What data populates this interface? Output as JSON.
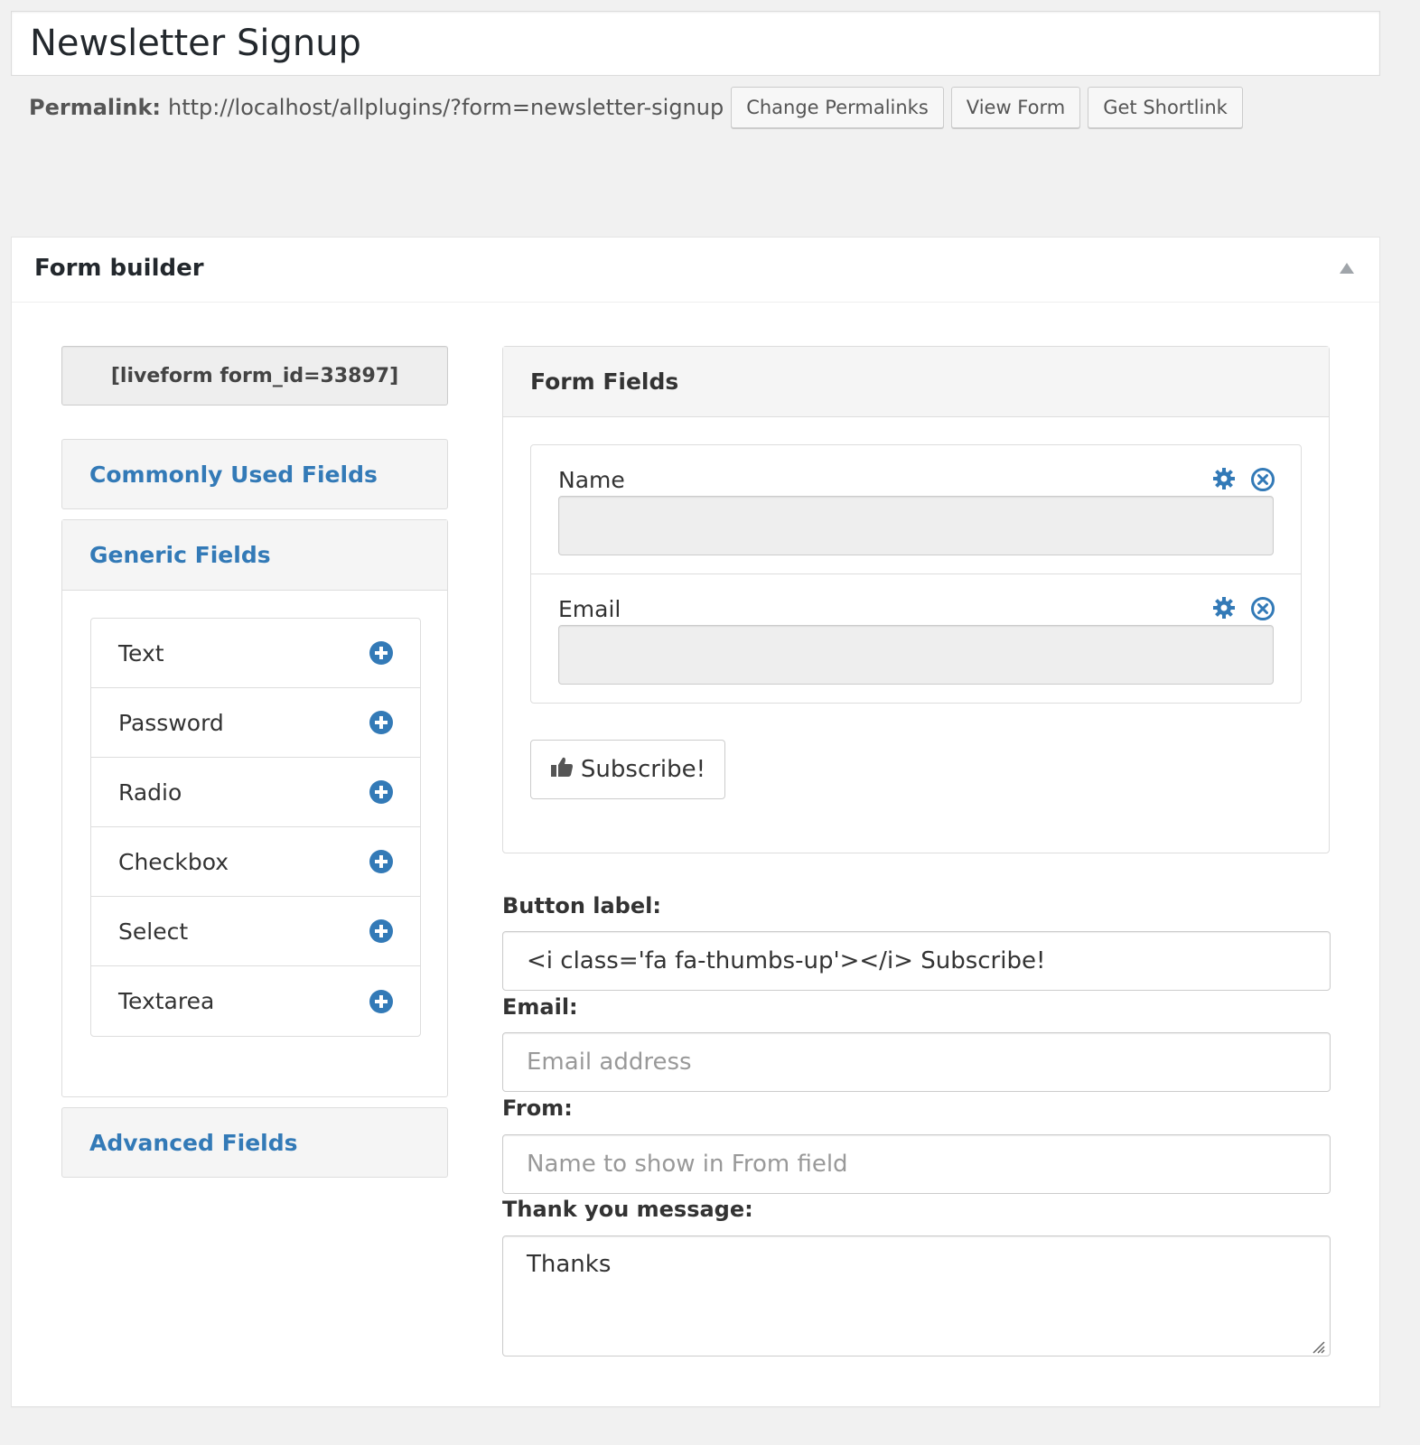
{
  "page": {
    "title": "Newsletter Signup"
  },
  "permalink": {
    "label": "Permalink:",
    "url": "http://localhost/allplugins/?form=newsletter-signup",
    "buttons": [
      "Change Permalinks",
      "View Form",
      "Get Shortlink"
    ]
  },
  "form_builder": {
    "title": "Form builder",
    "shortcode": "[liveform form_id=33897]",
    "sections": {
      "commonly_used": "Commonly Used Fields",
      "generic": "Generic Fields",
      "advanced": "Advanced Fields"
    },
    "generic_fields": [
      {
        "label": "Text"
      },
      {
        "label": "Password"
      },
      {
        "label": "Radio"
      },
      {
        "label": "Checkbox"
      },
      {
        "label": "Select"
      },
      {
        "label": "Textarea"
      }
    ],
    "form_fields_title": "Form Fields",
    "form_fields": [
      {
        "label": "Name"
      },
      {
        "label": "Email"
      }
    ],
    "submit_button": "Subscribe!"
  },
  "settings": {
    "button_label": {
      "label": "Button label:",
      "value": "<i class='fa fa-thumbs-up'></i> Subscribe!"
    },
    "email": {
      "label": "Email:",
      "placeholder": "Email address"
    },
    "from": {
      "label": "From:",
      "placeholder": "Name to show in From field"
    },
    "thank_you": {
      "label": "Thank you message:",
      "value": "Thanks"
    }
  },
  "colors": {
    "accent": "#337ab7",
    "background": "#f1f1f1"
  }
}
